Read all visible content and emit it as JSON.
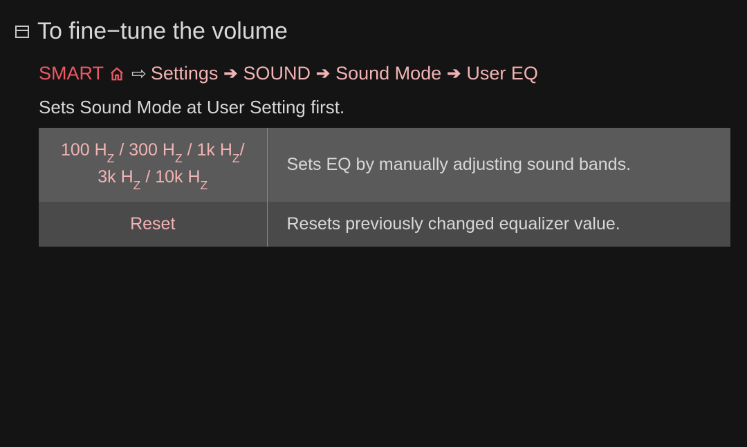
{
  "title": "To fine−tune the volume",
  "breadcrumb": {
    "smart": "SMART",
    "items": [
      "Settings",
      "SOUND",
      "Sound Mode",
      "User EQ"
    ]
  },
  "intro": "Sets Sound Mode at User Setting first.",
  "table": {
    "rows": [
      {
        "bands_prefix": "100 H",
        "sep": " / ",
        "b300": "300 H",
        "b1k": "1k H",
        "b3k": "3k H",
        "b10k": "10k H",
        "desc": "Sets EQ by manually adjusting sound bands."
      },
      {
        "label": "Reset",
        "desc": "Resets previously changed equalizer value."
      }
    ]
  }
}
